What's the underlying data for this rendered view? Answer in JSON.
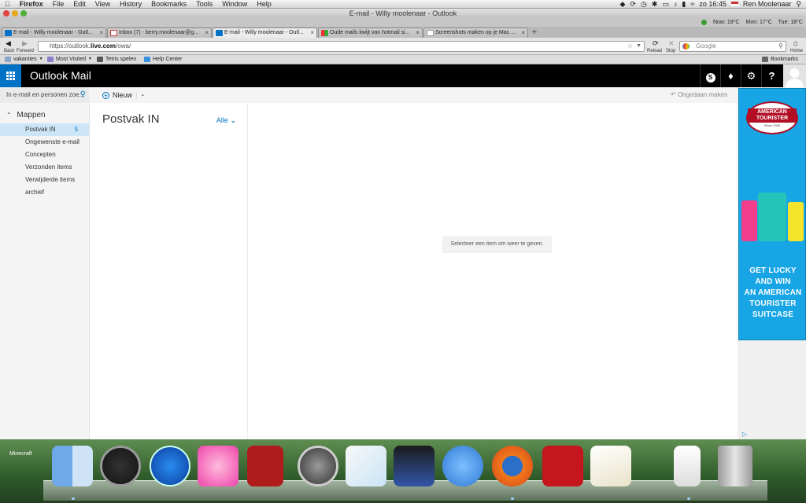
{
  "menubar": {
    "apple_icon": "apple-icon",
    "app": "Firefox",
    "menus": [
      "File",
      "Edit",
      "View",
      "History",
      "Bookmarks",
      "Tools",
      "Window",
      "Help"
    ],
    "clock": "zo 16:45",
    "user": "Ren Moolenaar"
  },
  "window": {
    "title": "E-mail - Willy moolenaar - Outlook"
  },
  "weather": {
    "now": "Now: 19°C",
    "mon": "Mon: 17°C",
    "tue": "Tue: 18°C"
  },
  "tabs": [
    {
      "label": "E-mail - Willy moolenaar - Outl...",
      "icon": "outlook-icon",
      "active": false
    },
    {
      "label": "Inbox (7) - berry.moolenaar@g...",
      "icon": "gmail-icon",
      "active": false
    },
    {
      "label": "E-mail - Willy moolenaar - Outl...",
      "icon": "outlook-icon",
      "active": true
    },
    {
      "label": "Oude mails kwijt van hotmail si...",
      "icon": "windows-icon",
      "active": false
    },
    {
      "label": "Screenshots maken op je Mac - ...",
      "icon": "page-icon",
      "active": false
    }
  ],
  "nav": {
    "back": "Back",
    "forward": "Forward",
    "url_prefix": "https://outlook.",
    "url_bold": "live.com",
    "url_suffix": "/owa/",
    "reload": "Reload",
    "stop": "Stop",
    "search_placeholder": "Google",
    "home": "Home"
  },
  "bookmarks": {
    "items": [
      "vakanties",
      "Most Visited",
      "Tetris spelen",
      "Help Center"
    ],
    "right": "Bookmarks"
  },
  "outlook": {
    "brand": "Outlook Mail",
    "search_placeholder": "In e-mail en personen zoe...",
    "new_label": "Nieuw",
    "undo_label": "Ongedaan maken",
    "folders_heading": "Mappen",
    "folders": [
      {
        "name": "Postvak IN",
        "count": "5",
        "selected": true
      },
      {
        "name": "Ongewenste e-mail",
        "count": "",
        "selected": false
      },
      {
        "name": "Concepten",
        "count": "",
        "selected": false
      },
      {
        "name": "Verzonden items",
        "count": "",
        "selected": false
      },
      {
        "name": "Verwijderde items",
        "count": "",
        "selected": false
      },
      {
        "name": "archief",
        "count": "",
        "selected": false
      }
    ],
    "list_title": "Postvak IN",
    "filter": "Alle",
    "reading_message": "Selecteer een item om weer te geven."
  },
  "ad": {
    "brand": "AMERICAN TOURISTER",
    "since": "Since 1933",
    "headline": [
      "GET LUCKY",
      "AND WIN",
      "AN AMERICAN",
      "TOURISTER",
      "SUITCASE"
    ],
    "colors": {
      "bg": "#17a5e6",
      "pink": "#f23c8c",
      "teal": "#25c4b8",
      "yellow": "#f2e52a"
    }
  },
  "dock": {
    "label": "Minecraft",
    "apps": [
      "finder-icon",
      "dashboard-icon",
      "itunes-icon",
      "butterfly-icon",
      "photo-booth-icon",
      "photos-icon",
      "time-machine-icon",
      "feather-icon",
      "imovie-icon",
      "facetime-icon",
      "firefox-icon",
      "acrobat-icon",
      "textedit-icon",
      "downloads-stack-icon",
      "trash-icon"
    ]
  },
  "colors": {
    "accent": "#0072c6",
    "selected_folder": "#cde6f7"
  }
}
